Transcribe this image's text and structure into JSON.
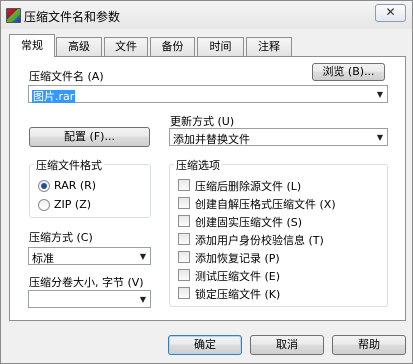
{
  "window": {
    "title": "压缩文件名和参数",
    "close_symbol": "✕"
  },
  "tabs": [
    {
      "label": "常规",
      "active": true
    },
    {
      "label": "高级",
      "active": false
    },
    {
      "label": "文件",
      "active": false
    },
    {
      "label": "备份",
      "active": false
    },
    {
      "label": "时间",
      "active": false
    },
    {
      "label": "注释",
      "active": false
    }
  ],
  "archive_name": {
    "label": "压缩文件名 (A)",
    "value": "图片.rar",
    "browse_label": "浏览 (B)..."
  },
  "update_mode": {
    "label": "更新方式 (U)",
    "value": "添加并替换文件"
  },
  "profiles_button": "配置 (F)...",
  "archive_format": {
    "label": "压缩文件格式",
    "options": [
      {
        "label": "RAR (R)",
        "checked": true
      },
      {
        "label": "ZIP (Z)",
        "checked": false
      }
    ]
  },
  "compression_method": {
    "label": "压缩方式 (C)",
    "value": "标准"
  },
  "split_volumes": {
    "label": "压缩分卷大小, 字节 (V)",
    "value": ""
  },
  "archive_options": {
    "label": "压缩选项",
    "items": [
      {
        "label": "压缩后删除源文件 (L)",
        "checked": false
      },
      {
        "label": "创建自解压格式压缩文件 (X)",
        "checked": false
      },
      {
        "label": "创建固实压缩文件 (S)",
        "checked": false
      },
      {
        "label": "添加用户身份校验信息 (T)",
        "checked": false
      },
      {
        "label": "添加恢复记录 (P)",
        "checked": false
      },
      {
        "label": "测试压缩文件 (E)",
        "checked": false
      },
      {
        "label": "锁定压缩文件 (K)",
        "checked": false
      }
    ]
  },
  "footer": {
    "ok_label": "确定",
    "cancel_label": "取消",
    "help_label": "帮助"
  },
  "colors": {
    "accent": "#3399ff",
    "radio_dot": "#1e4fa6"
  }
}
